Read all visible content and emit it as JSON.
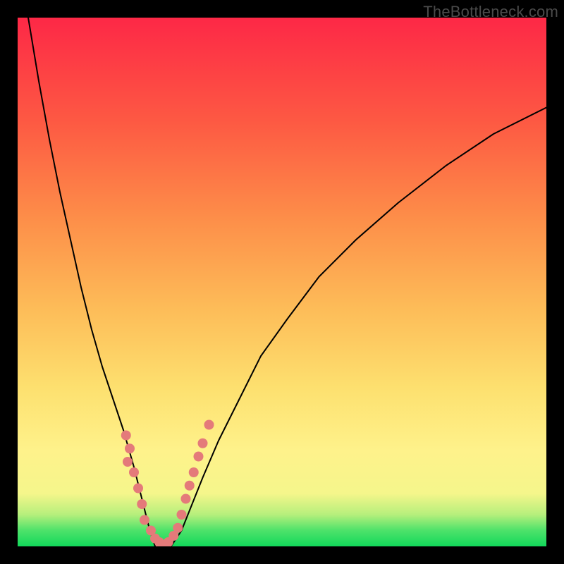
{
  "watermark": "TheBottleneck.com",
  "chart_data": {
    "type": "line",
    "title": "",
    "xlabel": "",
    "ylabel": "",
    "xlim": [
      0,
      100
    ],
    "ylim": [
      0,
      100
    ],
    "grid": false,
    "legend": false,
    "note": "Y scale shown as background rainbow gradient from green (0, bottom) through yellow/orange to red (100, top). No numeric axes rendered.",
    "background_gradient_stops": [
      {
        "pos": 0.0,
        "color": "#12d85a"
      },
      {
        "pos": 0.03,
        "color": "#4de26a"
      },
      {
        "pos": 0.06,
        "color": "#b6ef7c"
      },
      {
        "pos": 0.1,
        "color": "#f5f68b"
      },
      {
        "pos": 0.18,
        "color": "#fef28b"
      },
      {
        "pos": 0.3,
        "color": "#fde06f"
      },
      {
        "pos": 0.45,
        "color": "#fdbc58"
      },
      {
        "pos": 0.62,
        "color": "#fd8e49"
      },
      {
        "pos": 0.8,
        "color": "#fd5a43"
      },
      {
        "pos": 1.0,
        "color": "#fd2846"
      }
    ],
    "series": [
      {
        "name": "curve-left",
        "type": "line",
        "color": "#000000",
        "stroke_width": 2,
        "x": [
          2,
          4,
          6,
          8,
          10,
          12,
          14,
          16,
          18,
          20,
          22,
          23.5,
          25,
          26
        ],
        "y": [
          100,
          88,
          77,
          67,
          58,
          49,
          41,
          34,
          28,
          22,
          15,
          9,
          3,
          0
        ]
      },
      {
        "name": "curve-right",
        "type": "line",
        "color": "#000000",
        "stroke_width": 2,
        "x": [
          29,
          31,
          33,
          35,
          38,
          42,
          46,
          51,
          57,
          64,
          72,
          81,
          90,
          100
        ],
        "y": [
          0,
          3,
          8,
          13,
          20,
          28,
          36,
          43,
          51,
          58,
          65,
          72,
          78,
          83
        ]
      },
      {
        "name": "dots-left",
        "type": "scatter",
        "color": "#e47a7a",
        "marker_r": 7,
        "x": [
          20.5,
          21.2,
          20.8,
          22.0,
          22.8,
          23.5,
          24.0,
          25.2,
          26.0,
          26.8
        ],
        "y": [
          21.0,
          18.5,
          16.0,
          14.0,
          11.0,
          8.0,
          5.0,
          3.0,
          1.5,
          0.8
        ]
      },
      {
        "name": "dots-right",
        "type": "scatter",
        "color": "#e47a7a",
        "marker_r": 7,
        "x": [
          28.5,
          29.5,
          30.3,
          31.0,
          31.8,
          32.5,
          33.3,
          34.2,
          35.0,
          36.2
        ],
        "y": [
          0.8,
          2.0,
          3.5,
          6.0,
          9.0,
          11.5,
          14.0,
          17.0,
          19.5,
          23.0
        ]
      },
      {
        "name": "dots-bottom",
        "type": "scatter",
        "color": "#e47a7a",
        "marker_r": 7,
        "x": [
          27.0,
          27.6,
          28.2
        ],
        "y": [
          0.4,
          0.3,
          0.4
        ]
      }
    ]
  }
}
